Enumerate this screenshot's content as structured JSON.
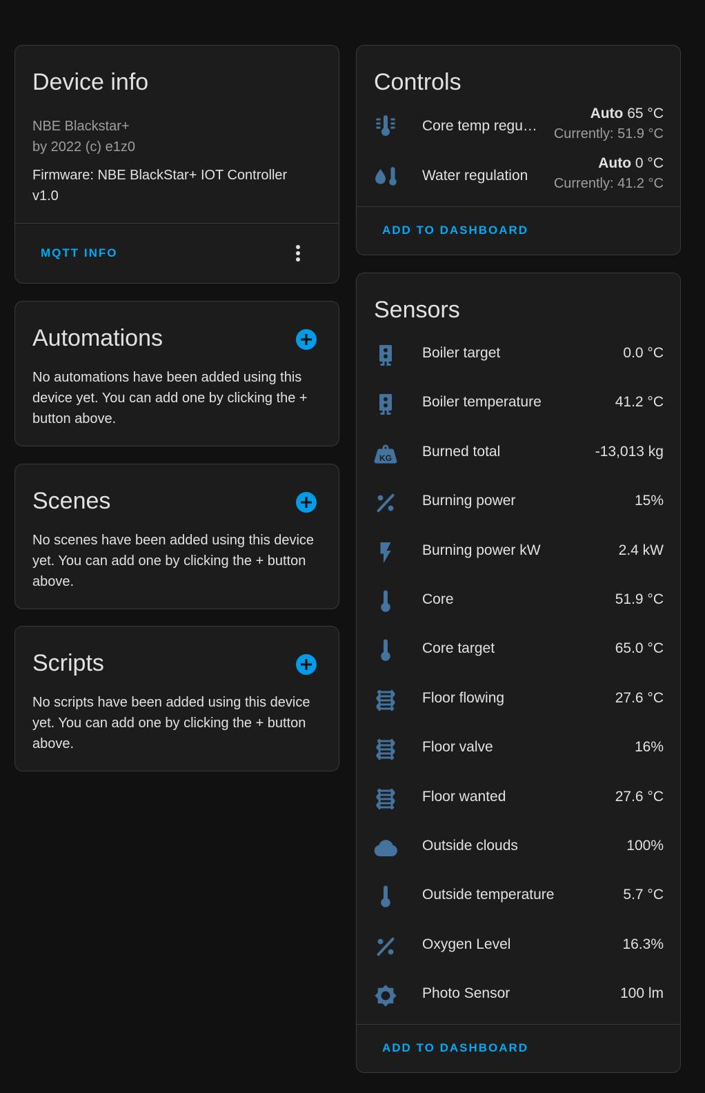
{
  "device_info": {
    "title": "Device info",
    "model": "NBE Blackstar+",
    "manufacturer": "by 2022 (c) e1z0",
    "firmware": "Firmware: NBE BlackStar+ IOT Controller v1.0",
    "mqtt_label": "MQTT INFO"
  },
  "automations": {
    "title": "Automations",
    "text": "No automations have been added using this device yet. You can add one by clicking the + button above."
  },
  "scenes": {
    "title": "Scenes",
    "text": "No scenes have been added using this device yet. You can add one by clicking the + button above."
  },
  "scripts": {
    "title": "Scripts",
    "text": "No scripts have been added using this device yet. You can add one by clicking the + button above."
  },
  "controls": {
    "title": "Controls",
    "items": [
      {
        "name": "Core temp regu…",
        "mode": "Auto",
        "target": "65 °C",
        "current": "Currently: 51.9 °C",
        "icon": "thermometer-lines-icon"
      },
      {
        "name": "Water regulation",
        "mode": "Auto",
        "target": "0 °C",
        "current": "Currently: 41.2 °C",
        "icon": "water-thermometer-icon"
      }
    ],
    "add_label": "ADD TO DASHBOARD"
  },
  "sensors": {
    "title": "Sensors",
    "items": [
      {
        "name": "Boiler target",
        "value": "0.0 °C",
        "icon": "water-boiler-icon"
      },
      {
        "name": "Boiler temperature",
        "value": "41.2 °C",
        "icon": "water-boiler-icon"
      },
      {
        "name": "Burned total",
        "value": "-13,013 kg",
        "icon": "weight-kilogram-icon"
      },
      {
        "name": "Burning power",
        "value": "15%",
        "icon": "percent-icon"
      },
      {
        "name": "Burning power kW",
        "value": "2.4 kW",
        "icon": "flash-icon"
      },
      {
        "name": "Core",
        "value": "51.9 °C",
        "icon": "thermometer-icon"
      },
      {
        "name": "Core target",
        "value": "65.0 °C",
        "icon": "thermometer-icon"
      },
      {
        "name": "Floor flowing",
        "value": "27.6 °C",
        "icon": "heating-coil-icon"
      },
      {
        "name": "Floor valve",
        "value": "16%",
        "icon": "heating-coil-icon"
      },
      {
        "name": "Floor wanted",
        "value": "27.6 °C",
        "icon": "heating-coil-icon"
      },
      {
        "name": "Outside clouds",
        "value": "100%",
        "icon": "cloud-icon"
      },
      {
        "name": "Outside temperature",
        "value": "5.7 °C",
        "icon": "thermometer-icon"
      },
      {
        "name": "Oxygen Level",
        "value": "16.3%",
        "icon": "percent-icon"
      },
      {
        "name": "Photo Sensor",
        "value": "100 lm",
        "icon": "brightness-icon"
      }
    ],
    "add_label": "ADD TO DASHBOARD"
  },
  "colors": {
    "accent": "#03a9f4",
    "icon": "#44739e",
    "background": "#111111",
    "card": "#1c1c1c"
  }
}
